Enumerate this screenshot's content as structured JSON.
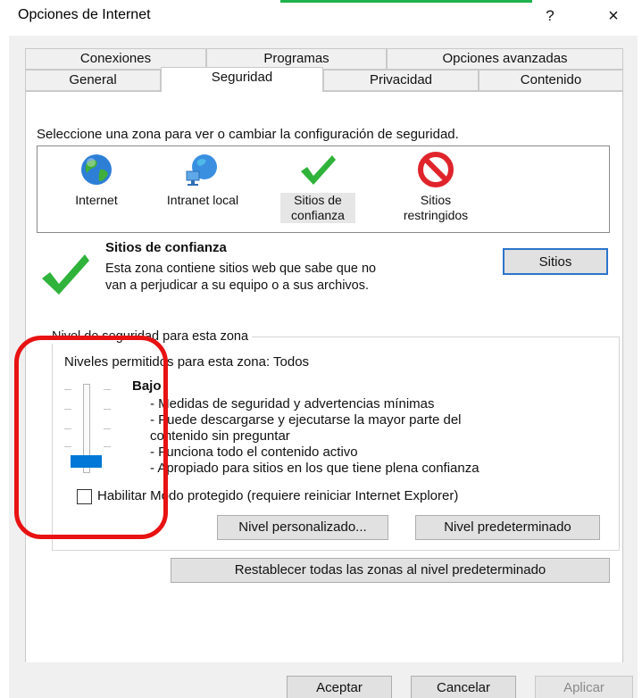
{
  "window": {
    "title": "Opciones de Internet",
    "help_glyph": "?",
    "close_glyph": "×"
  },
  "tabs": {
    "row1": [
      "Conexiones",
      "Programas",
      "Opciones avanzadas"
    ],
    "row2": [
      "General",
      "Seguridad",
      "Privacidad",
      "Contenido"
    ],
    "active": "Seguridad"
  },
  "zones": {
    "prompt": "Seleccione una zona para ver o cambiar la configuración de seguridad.",
    "items": [
      {
        "line1": "Internet",
        "line2": "",
        "icon": "globe-icon"
      },
      {
        "line1": "Intranet local",
        "line2": "",
        "icon": "network-globe-icon"
      },
      {
        "line1": "Sitios de",
        "line2": "confianza",
        "icon": "checkmark-icon"
      },
      {
        "line1": "Sitios",
        "line2": "restringidos",
        "icon": "prohibited-icon"
      }
    ],
    "selected_index": 2
  },
  "selected_zone": {
    "title": "Sitios de confianza",
    "desc_line1": "Esta zona contiene sitios web que sabe que no",
    "desc_line2": "van a perjudicar a su equipo o a sus archivos.",
    "sites_button": "Sitios"
  },
  "level": {
    "legend": "Nivel de seguridad para esta zona",
    "allowed": "Niveles permitidos para esta zona: Todos",
    "name": "Bajo",
    "bullets": [
      "- Medidas de seguridad y advertencias mínimas",
      "- Puede descargarse y ejecutarse la mayor parte del",
      "  contenido sin preguntar",
      "- Funciona todo el contenido activo",
      "- Apropiado para sitios en los que tiene plena confianza"
    ],
    "slider_value": "Bajo",
    "protected_mode_label": "Habilitar Modo protegido (requiere reiniciar Internet Explorer)",
    "protected_mode_checked": false,
    "custom_button": "Nivel personalizado...",
    "default_button": "Nivel predeterminado"
  },
  "reset_button": "Restablecer todas las zonas al nivel predeterminado",
  "footer": {
    "ok": "Aceptar",
    "cancel": "Cancelar",
    "apply": "Aplicar"
  },
  "colors": {
    "accent": "#0078d7",
    "annotation": "#e81212",
    "check_green": "#2fb33a",
    "prohibit_red": "#e0242b"
  }
}
